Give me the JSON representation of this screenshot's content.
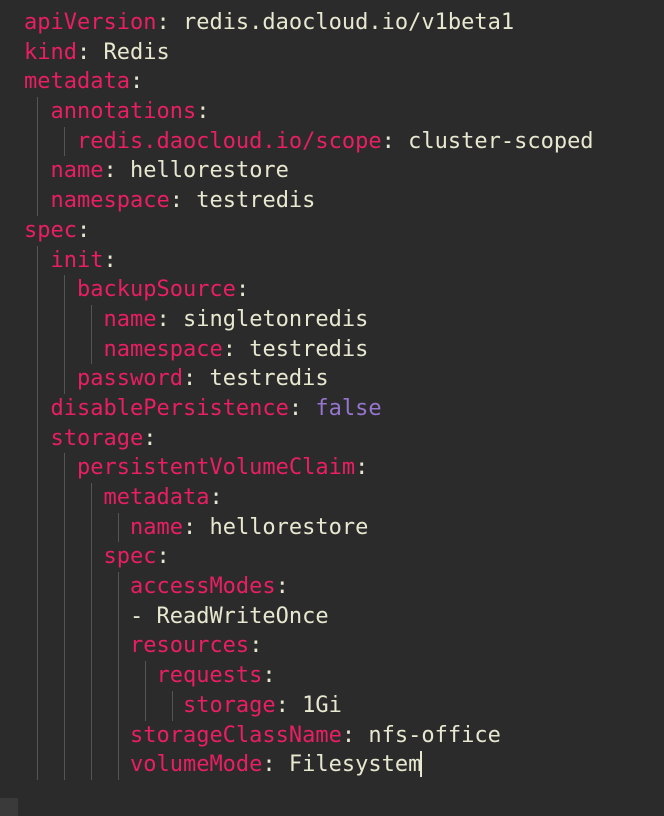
{
  "yaml": {
    "apiVersion_key": "apiVersion",
    "apiVersion_val": "redis.daocloud.io/v1beta1",
    "kind_key": "kind",
    "kind_val": "Redis",
    "metadata_key": "metadata",
    "annotations_key": "annotations",
    "scope_key": "redis.daocloud.io/scope",
    "scope_val": "cluster-scoped",
    "name_key": "name",
    "metadata_name_val": "hellorestore",
    "namespace_key": "namespace",
    "metadata_namespace_val": "testredis",
    "spec_key": "spec",
    "init_key": "init",
    "backupSource_key": "backupSource",
    "backupSource_name_val": "singletonredis",
    "backupSource_namespace_val": "testredis",
    "password_key": "password",
    "password_val": "testredis",
    "disablePersistence_key": "disablePersistence",
    "disablePersistence_val": "false",
    "storage_key": "storage",
    "pvc_key": "persistentVolumeClaim",
    "pvc_metadata_key": "metadata",
    "pvc_name_val": "hellorestore",
    "pvc_spec_key": "spec",
    "accessModes_key": "accessModes",
    "accessModes_item": "- ReadWriteOnce",
    "resources_key": "resources",
    "requests_key": "requests",
    "storage_size_key": "storage",
    "storage_size_val": "1Gi",
    "storageClassName_key": "storageClassName",
    "storageClassName_val": "nfs-office",
    "volumeMode_key": "volumeMode",
    "volumeMode_val": "Filesystem"
  }
}
